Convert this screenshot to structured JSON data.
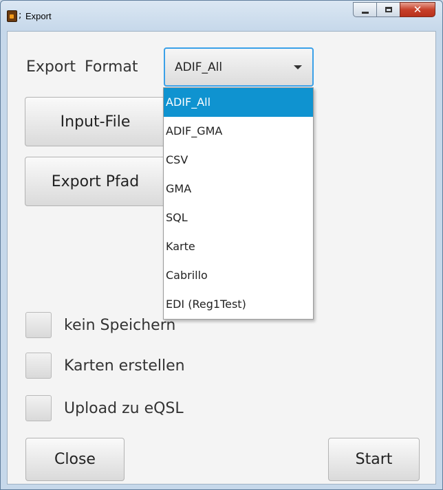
{
  "window": {
    "title": "Export",
    "icon": "app-icon",
    "icon_suffix": ";",
    "controls": {
      "minimize": "minimize-icon",
      "maximize": "maximize-icon",
      "close": "close-icon",
      "close_glyph": "✕"
    }
  },
  "format": {
    "label": "Export Format",
    "selected": "ADIF_All",
    "options": [
      "ADIF_All",
      "ADIF_GMA",
      "CSV",
      "GMA",
      "SQL",
      "Karte",
      "Cabrillo",
      "EDI (Reg1Test)"
    ]
  },
  "buttons": {
    "input_file": "Input-File",
    "export_path": "Export Pfad",
    "close": "Close",
    "start": "Start"
  },
  "checkboxes": [
    {
      "label": "kein Speichern",
      "checked": false
    },
    {
      "label": "Karten erstellen",
      "checked": false
    },
    {
      "label": "Upload zu eQSL",
      "checked": false
    }
  ],
  "colors": {
    "accent": "#0f93d0",
    "focus_border": "#3aa0e8",
    "close_button": "#c7412a"
  }
}
